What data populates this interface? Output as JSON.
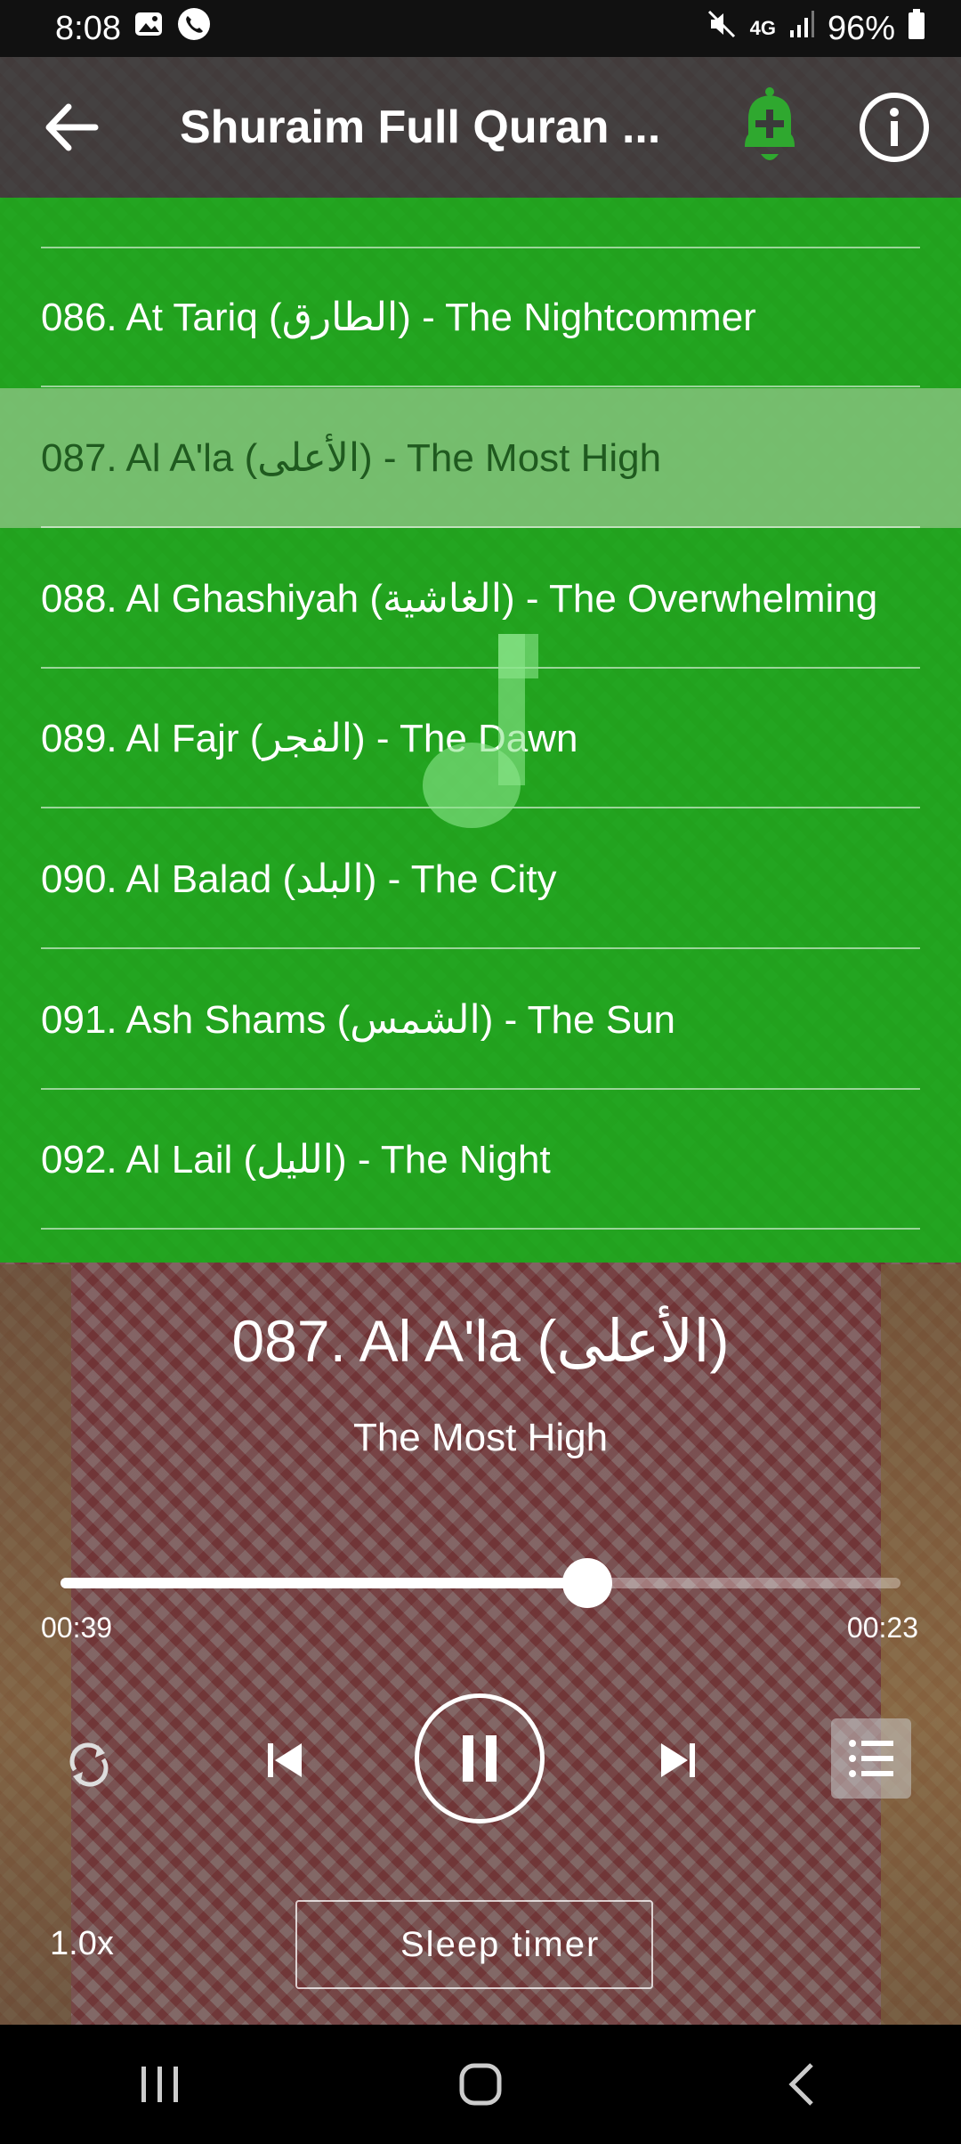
{
  "status_bar": {
    "time": "8:08",
    "network": "4G",
    "battery": "96%"
  },
  "app_bar": {
    "title": "Shuraim Full Quran ..."
  },
  "playlist": {
    "tracks": [
      {
        "label": "086. At Tariq (الطارق) - The Nightcommer",
        "active": false
      },
      {
        "label": "087. Al A'la (الأعلى) - The Most High",
        "active": true
      },
      {
        "label": "088. Al Ghashiyah (الغاشية) - The Overwhelming",
        "active": false
      },
      {
        "label": "089. Al Fajr (الفجر) - The Dawn",
        "active": false
      },
      {
        "label": "090. Al Balad (البلد) - The City",
        "active": false
      },
      {
        "label": "091. Ash Shams (الشمس) - The Sun",
        "active": false
      },
      {
        "label": "092. Al Lail (الليل) - The Night",
        "active": false
      }
    ]
  },
  "now_playing": {
    "title": "087. Al A'la (الأعلى)",
    "subtitle": "The Most High",
    "elapsed": "00:39",
    "remaining": "00:23",
    "progress": 0.627
  },
  "controls": {
    "speed": "1.0x",
    "sleep_timer_label": "Sleep timer"
  },
  "colors": {
    "playlist_bg": "#1caa1c",
    "active_row": "#96c88c",
    "bell_icon": "#2fa82f"
  }
}
